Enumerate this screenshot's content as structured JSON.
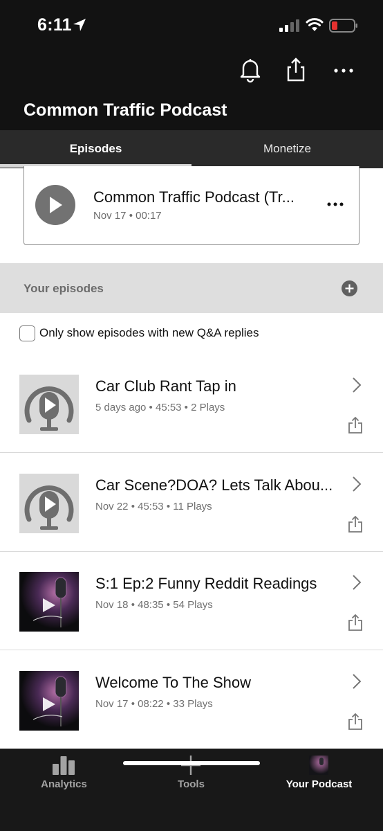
{
  "status_bar": {
    "time": "6:11"
  },
  "header": {
    "podcast_title": "Common Traffic Podcast"
  },
  "tabs": [
    {
      "label": "Episodes",
      "active": true
    },
    {
      "label": "Monetize",
      "active": false
    }
  ],
  "featured": {
    "title": "Common Traffic Podcast (Tr...",
    "meta": "Nov 17 • 00:17"
  },
  "episodes_section": {
    "label": "Your episodes",
    "filter_label": "Only show episodes with new Q&A replies"
  },
  "episodes": [
    {
      "title": "Car Club Rant Tap in",
      "meta": "5 days ago • 45:53 • 2 Plays",
      "thumb": "mic-icon"
    },
    {
      "title": "Car Scene?DOA? Lets Talk Abou...",
      "meta": "Nov 22 • 45:53 • 11 Plays",
      "thumb": "mic-icon"
    },
    {
      "title": "S:1 Ep:2 Funny Reddit Readings",
      "meta": "Nov 18 • 48:35 • 54 Plays",
      "thumb": "podcast-art"
    },
    {
      "title": "Welcome To The Show",
      "meta": "Nov 17 • 08:22 • 33 Plays",
      "thumb": "podcast-art"
    }
  ],
  "bottom_nav": [
    {
      "label": "Analytics",
      "icon": "bar-chart-icon",
      "active": false
    },
    {
      "label": "Tools",
      "icon": "plus-icon",
      "active": false
    },
    {
      "label": "Your Podcast",
      "icon": "podcast-art",
      "active": true
    }
  ],
  "colors": {
    "header_bg": "#121212",
    "tab_bg": "#2a2a2a",
    "section_bg": "#dedede",
    "nav_bg": "#181818",
    "battery_low": "#e5312f"
  }
}
